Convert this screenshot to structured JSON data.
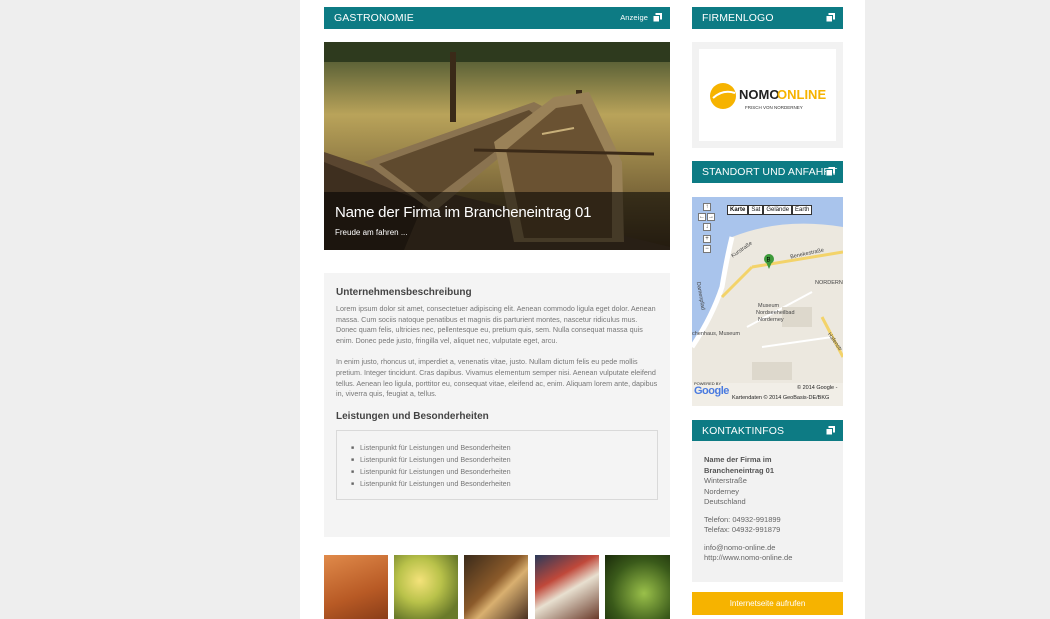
{
  "main": {
    "section_title": "GASTRONOMIE",
    "ad_label": "Anzeige",
    "hero": {
      "title": "Name der Firma im Brancheneintrag 01",
      "subtitle": "Freude am fahren ..."
    },
    "description": {
      "heading": "Unternehmensbeschreibung",
      "paragraph1": "Lorem ipsum dolor sit amet, consectetuer adipiscing elit. Aenean commodo ligula eget dolor. Aenean massa. Cum sociis natoque penatibus et magnis dis parturient montes, nascetur ridiculus mus. Donec quam felis, ultricies nec, pellentesque eu, pretium quis, sem. Nulla consequat massa quis enim. Donec pede justo, fringilla vel, aliquet nec, vulputate eget, arcu.",
      "paragraph2": "In enim justo, rhoncus ut, imperdiet a, venenatis vitae, justo. Nullam dictum felis eu pede mollis pretium. Integer tincidunt. Cras dapibus. Vivamus elementum semper nisi. Aenean vulputate eleifend tellus. Aenean leo ligula, porttitor eu, consequat vitae, eleifend ac, enim. Aliquam lorem ante, dapibus in, viverra quis, feugiat a, tellus.",
      "services_heading": "Leistungen und Besonderheiten",
      "services": [
        "Listenpunkt für Leistungen und Besonderheiten",
        "Listenpunkt für Leistungen und Besonderheiten",
        "Listenpunkt für Leistungen und Besonderheiten",
        "Listenpunkt für Leistungen und Besonderheiten"
      ]
    }
  },
  "sidebar": {
    "logo_title": "FIRMENLOGO",
    "logo": {
      "name_dark": "NOMO",
      "name_accent": "ONLINE",
      "tagline": "FRISCH VON NORDERNEY"
    },
    "location_title": "STANDORT UND ANFAHRT",
    "map": {
      "types": [
        "Karte",
        "Sat",
        "Gelände",
        "Earth"
      ],
      "zoom_in": "+",
      "zoom_out": "−",
      "marker": "B",
      "labels": {
        "street1": "Kurstraße",
        "street2": "Benekestraße",
        "area": "NORDERN",
        "street3": "Damenpfad",
        "museum": "Museum",
        "museum2": "Nordseeheilbad",
        "museum3": "Norderney",
        "poi": "chenhaus, Museum",
        "street4": "Hafenstr"
      },
      "copyright1": "© 2014 Google -",
      "copyright2": "Kartendaten © 2014 GeoBasis-DE/BKG",
      "powered": "POWERED BY",
      "google": "Google"
    },
    "contact_title": "KONTAKTINFOS",
    "contact": {
      "name_line1": "Name der Firma im",
      "name_line2": "Brancheneintrag 01",
      "street": "Winterstraße",
      "city": "Norderney",
      "country": "Deutschland",
      "phone": "Telefon: 04932-991899",
      "fax": "Telefax: 04932-991879",
      "email": "info@nomo-online.de",
      "web": "http://www.nomo-online.de"
    },
    "cta": "Internetseite aufrufen"
  },
  "colors": {
    "teal": "#0d7b84",
    "orange": "#f6b300",
    "gutter": "#eeeeee"
  }
}
